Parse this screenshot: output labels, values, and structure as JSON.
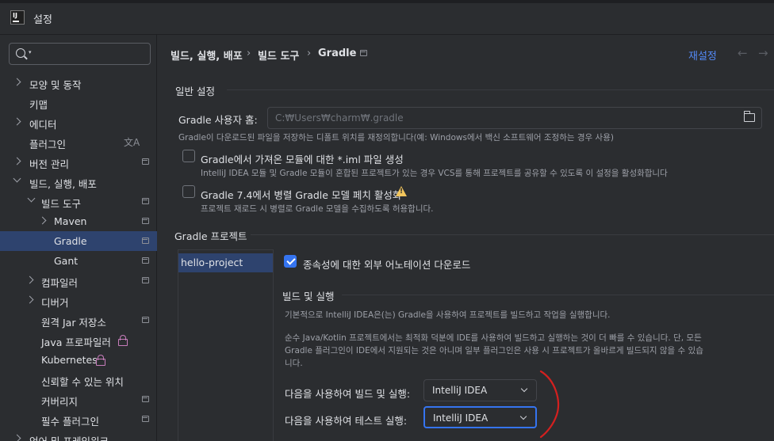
{
  "window": {
    "title": "설정"
  },
  "sidebar": {
    "search_placeholder": "",
    "items": [
      {
        "label": "모양 및 동작"
      },
      {
        "label": "키맵"
      },
      {
        "label": "에디터"
      },
      {
        "label": "플러그인"
      },
      {
        "label": "버전 관리"
      },
      {
        "label": "빌드, 실행, 배포"
      },
      {
        "label": "빌드 도구"
      },
      {
        "label": "Maven"
      },
      {
        "label": "Gradle"
      },
      {
        "label": "Gant"
      },
      {
        "label": "컴파일러"
      },
      {
        "label": "디버거"
      },
      {
        "label": "원격 Jar 저장소"
      },
      {
        "label": "Java 프로파일러"
      },
      {
        "label": "Kubernetes"
      },
      {
        "label": "신뢰할 수 있는 위치"
      },
      {
        "label": "커버리지"
      },
      {
        "label": "필수 플러그인"
      },
      {
        "label": "언어 및 프레임워크"
      }
    ]
  },
  "breadcrumb": {
    "items": [
      "빌드, 실행, 배포",
      "빌드 도구",
      "Gradle"
    ],
    "separator": "›"
  },
  "header": {
    "reset_label": "재설정",
    "back": "←",
    "forward": "→"
  },
  "general": {
    "title": "일반 설정",
    "gradle_home_label": "Gradle 사용자 홈:",
    "gradle_home_value": "C:₩Users₩charm₩.gradle",
    "gradle_home_hint": "Gradle이 다운로드된 파일을 저장하는 디폴트 위치를 재정의합니다(예: Windows에서 백신 소프트웨어 조정하는 경우 사용)",
    "iml_label": "Gradle에서 가져온 모듈에 대한 *.iml 파일 생성",
    "iml_hint": "IntelliJ IDEA 모듈 및 Gradle 모듈이 혼합된 프로젝트가 있는 경우 VCS를 통해 프로젝트를 공유할 수 있도록 이 설정을 활성화합니다",
    "parallel_label": "Gradle 7.4에서 병렬 Gradle 모델 페치 활성화",
    "parallel_hint": "프로젝트 재로드 시 병렬로 Gradle 모델을 수집하도록 허용합니다."
  },
  "projects": {
    "title": "Gradle 프로젝트",
    "list": [
      "hello-project"
    ],
    "download_annotations_label": "종속성에 대한 외부 어노테이션 다운로드",
    "build_run_title": "빌드 및 실행",
    "build_run_desc1": "기본적으로 IntelliJ IDEA은(는) Gradle을 사용하여 프로젝트를 빌드하고 작업을 실행합니다.",
    "build_run_desc2_line1": "순수 Java/Kotlin 프로젝트에서는 최적화 덕분에 IDE를 사용하여 빌드하고 실행하는 것이 더 빠를 수 있습니다. 단, 모든",
    "build_run_desc2_line2": "Gradle 플러그인이 IDE에서 지원되는 것은 아니며 일부 플러그인은 사용 시 프로젝트가 올바르게 빌드되지 않을 수 있습",
    "build_run_desc2_line3": "니다.",
    "build_using_label": "다음을 사용하여 빌드 및 실행:",
    "build_using_value": "IntelliJ IDEA",
    "test_using_label": "다음을 사용하여 테스트 실행:",
    "test_using_value": "IntelliJ IDEA"
  },
  "colors": {
    "accent": "#3574f0",
    "selection": "#2e436e",
    "link": "#548af7",
    "annotation": "#d3201f"
  },
  "icons": [
    "app-logo-icon",
    "search-icon",
    "chevron-right-icon",
    "chevron-down-icon",
    "project-scope-icon",
    "lock-icon",
    "translate-icon",
    "folder-icon",
    "warning-icon",
    "check-icon"
  ]
}
